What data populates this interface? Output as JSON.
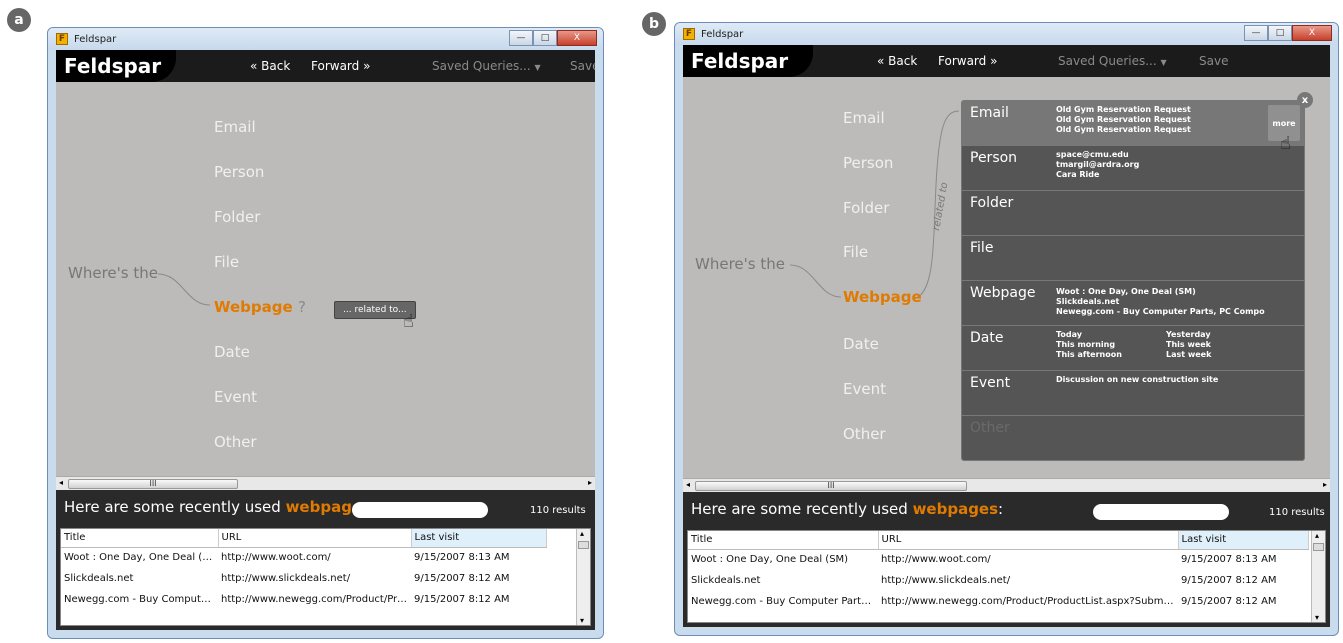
{
  "panels": {
    "a": "a",
    "b": "b"
  },
  "app": {
    "window_title": "Feldspar",
    "app_icon": "F",
    "brand": "Feldspar",
    "back": "« Back",
    "forward": "Forward »",
    "saved_queries": "Saved Queries...",
    "saved_queries_caret": "▼",
    "save_a": "Save",
    "save_b": "Save"
  },
  "window_controls": {
    "minimize": "—",
    "maximize": "□",
    "close": "X"
  },
  "query": {
    "prefix": "Where's the",
    "words": [
      "Email",
      "Person",
      "Folder",
      "File",
      "Webpage",
      "Date",
      "Event",
      "Other"
    ],
    "question_mark": "?",
    "related_button": "... related to...",
    "related_label": "related to"
  },
  "popup": {
    "close": "x",
    "more": "more",
    "rows": [
      {
        "label": "Email",
        "items": [
          "Old Gym Reservation Request",
          "Old Gym Reservation Request",
          "Old Gym Reservation Request"
        ]
      },
      {
        "label": "Person",
        "items": [
          "space@cmu.edu",
          "tmargil@ardra.org",
          "Cara Ride"
        ]
      },
      {
        "label": "Folder",
        "items": []
      },
      {
        "label": "File",
        "items": []
      },
      {
        "label": "Webpage",
        "items": [
          "Woot : One Day, One Deal (SM)",
          "Slickdeals.net",
          "Newegg.com - Buy Computer Parts, PC Compo"
        ]
      },
      {
        "label": "Date",
        "items": [
          "Today",
          "This morning",
          "This afternoon"
        ],
        "items2": [
          "Yesterday",
          "This week",
          "Last week"
        ]
      },
      {
        "label": "Event",
        "items": [
          "Discussion on new construction site"
        ]
      },
      {
        "label": "Other",
        "items": []
      }
    ]
  },
  "scroll": {
    "thumb": "III",
    "left": "◂",
    "right": "▸",
    "up": "▴",
    "down": "▾"
  },
  "results": {
    "prefix": "Here are some recently used ",
    "keyword": "webpages",
    "suffix": ":",
    "count": "110 results",
    "columns": [
      "Title",
      "URL",
      "Last visit"
    ],
    "rows_a": [
      [
        "Woot : One Day, One Deal (SM)",
        "http://www.woot.com/",
        "9/15/2007 8:13 AM"
      ],
      [
        "Slickdeals.net",
        "http://www.slickdeals.net/",
        "9/15/2007 8:12 AM"
      ],
      [
        "Newegg.com - Buy Computer...",
        "http://www.newegg.com/Product/Pro...",
        "9/15/2007 8:12 AM"
      ]
    ],
    "rows_b": [
      [
        "Woot : One Day, One Deal (SM)",
        "http://www.woot.com/",
        "9/15/2007 8:13 AM"
      ],
      [
        "Slickdeals.net",
        "http://www.slickdeals.net/",
        "9/15/2007 8:12 AM"
      ],
      [
        "Newegg.com - Buy Computer Parts,...",
        "http://www.newegg.com/Product/ProductList.aspx?Submit...",
        "9/15/2007 8:12 AM"
      ]
    ]
  },
  "colors": {
    "accent": "#e07a00",
    "header": "#1b1b1b",
    "canvas": "#bcbbb9"
  }
}
